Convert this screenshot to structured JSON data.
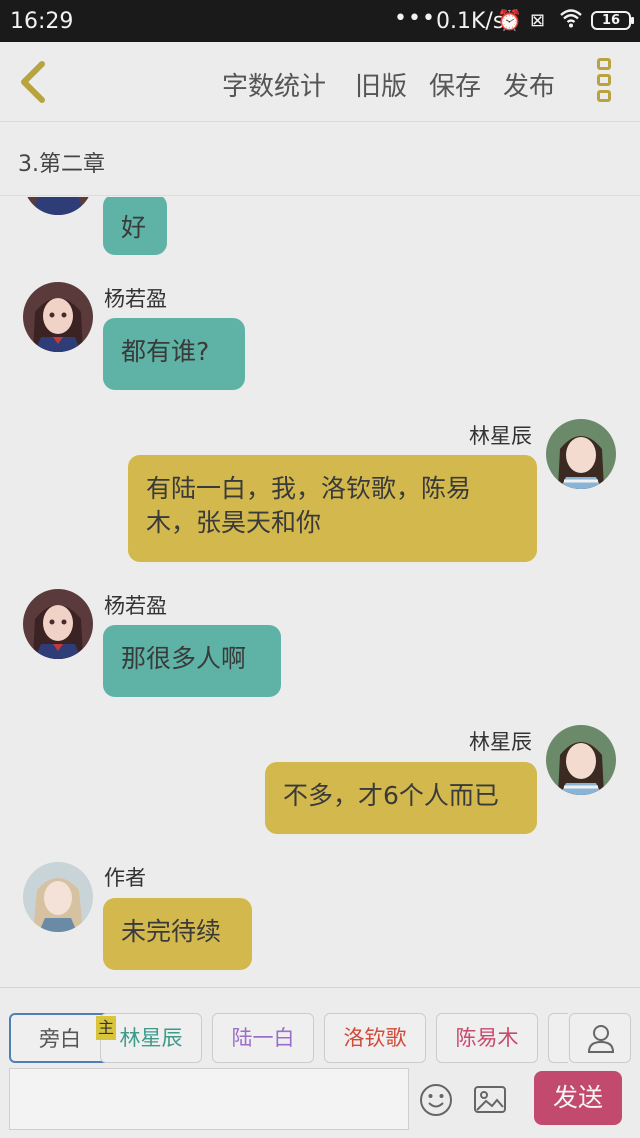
{
  "status": {
    "time": "16:29",
    "speed": "0.1K/s",
    "battery": "16"
  },
  "toolbar": {
    "word_count": "字数统计",
    "old_version": "旧版",
    "save": "保存",
    "publish": "发布"
  },
  "chapter": {
    "title": "3.第二章"
  },
  "messages": [
    {
      "side": "left",
      "sender": "",
      "text": "好",
      "color": "#5fb3a6"
    },
    {
      "side": "left",
      "sender": "杨若盈",
      "text": "都有谁?",
      "color": "#5fb3a6"
    },
    {
      "side": "right",
      "sender": "林星辰",
      "text": "有陆一白，我，洛钦歌，陈易木，张昊天和你",
      "color": "#d2b84d"
    },
    {
      "side": "left",
      "sender": "杨若盈",
      "text": "那很多人啊",
      "color": "#5fb3a6"
    },
    {
      "side": "right",
      "sender": "林星辰",
      "text": "不多，才6个人而已",
      "color": "#d2b84d"
    },
    {
      "side": "left",
      "sender": "作者",
      "text": "未完待续",
      "color": "#d2b84d"
    }
  ],
  "characters": [
    {
      "label": "旁白",
      "color": "#555555"
    },
    {
      "label": "林星辰",
      "color": "#3f9a8c",
      "main_badge": "主"
    },
    {
      "label": "陆一白",
      "color": "#9b6fc9"
    },
    {
      "label": "洛钦歌",
      "color": "#d24a3a"
    },
    {
      "label": "陈易木",
      "color": "#c84a6e"
    }
  ],
  "composer": {
    "placeholder": "",
    "send_label": "发送"
  }
}
